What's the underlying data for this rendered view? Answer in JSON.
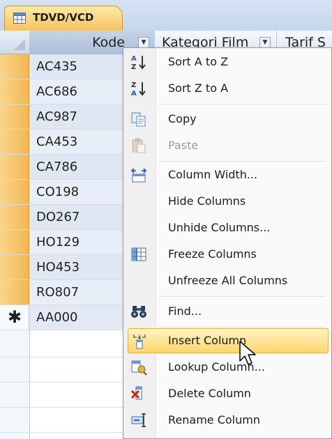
{
  "tab": {
    "label": "TDVD/VCD",
    "icon": "table-icon"
  },
  "columns": [
    {
      "label": "Kode"
    },
    {
      "label": "Kategori Film"
    },
    {
      "label": "Tarif S"
    }
  ],
  "rows": [
    "AC435",
    "AC686",
    "AC987",
    "CA453",
    "CA786",
    "CO198",
    "DO267",
    "HO129",
    "HO453",
    "RO807"
  ],
  "new_row": {
    "marker": "✱",
    "value": "AA000"
  },
  "context_menu": {
    "items": [
      {
        "label": "Sort A to Z",
        "icon": "sort-ascending-icon",
        "enabled": true
      },
      {
        "label": "Sort Z to A",
        "icon": "sort-descending-icon",
        "enabled": true
      },
      {
        "label": "Copy",
        "icon": "copy-icon",
        "enabled": true
      },
      {
        "label": "Paste",
        "icon": "paste-icon",
        "enabled": false
      },
      {
        "label": "Column Width...",
        "icon": "column-width-icon",
        "enabled": true
      },
      {
        "label": "Hide Columns",
        "icon": "",
        "enabled": true
      },
      {
        "label": "Unhide Columns...",
        "icon": "",
        "enabled": true
      },
      {
        "label": "Freeze Columns",
        "icon": "freeze-columns-icon",
        "enabled": true
      },
      {
        "label": "Unfreeze All Columns",
        "icon": "",
        "enabled": true
      },
      {
        "label": "Find...",
        "icon": "binoculars-icon",
        "enabled": true
      },
      {
        "label": "Insert Column",
        "icon": "insert-column-icon",
        "enabled": true,
        "highlighted": true
      },
      {
        "label": "Lookup Column...",
        "icon": "lookup-column-icon",
        "enabled": true
      },
      {
        "label": "Delete Column",
        "icon": "delete-column-icon",
        "enabled": true
      },
      {
        "label": "Rename Column",
        "icon": "rename-column-icon",
        "enabled": true
      }
    ]
  },
  "colors": {
    "selected_row": "#f2b752",
    "tab": "#f7c35f",
    "menu_highlight": "#fbd56d"
  }
}
